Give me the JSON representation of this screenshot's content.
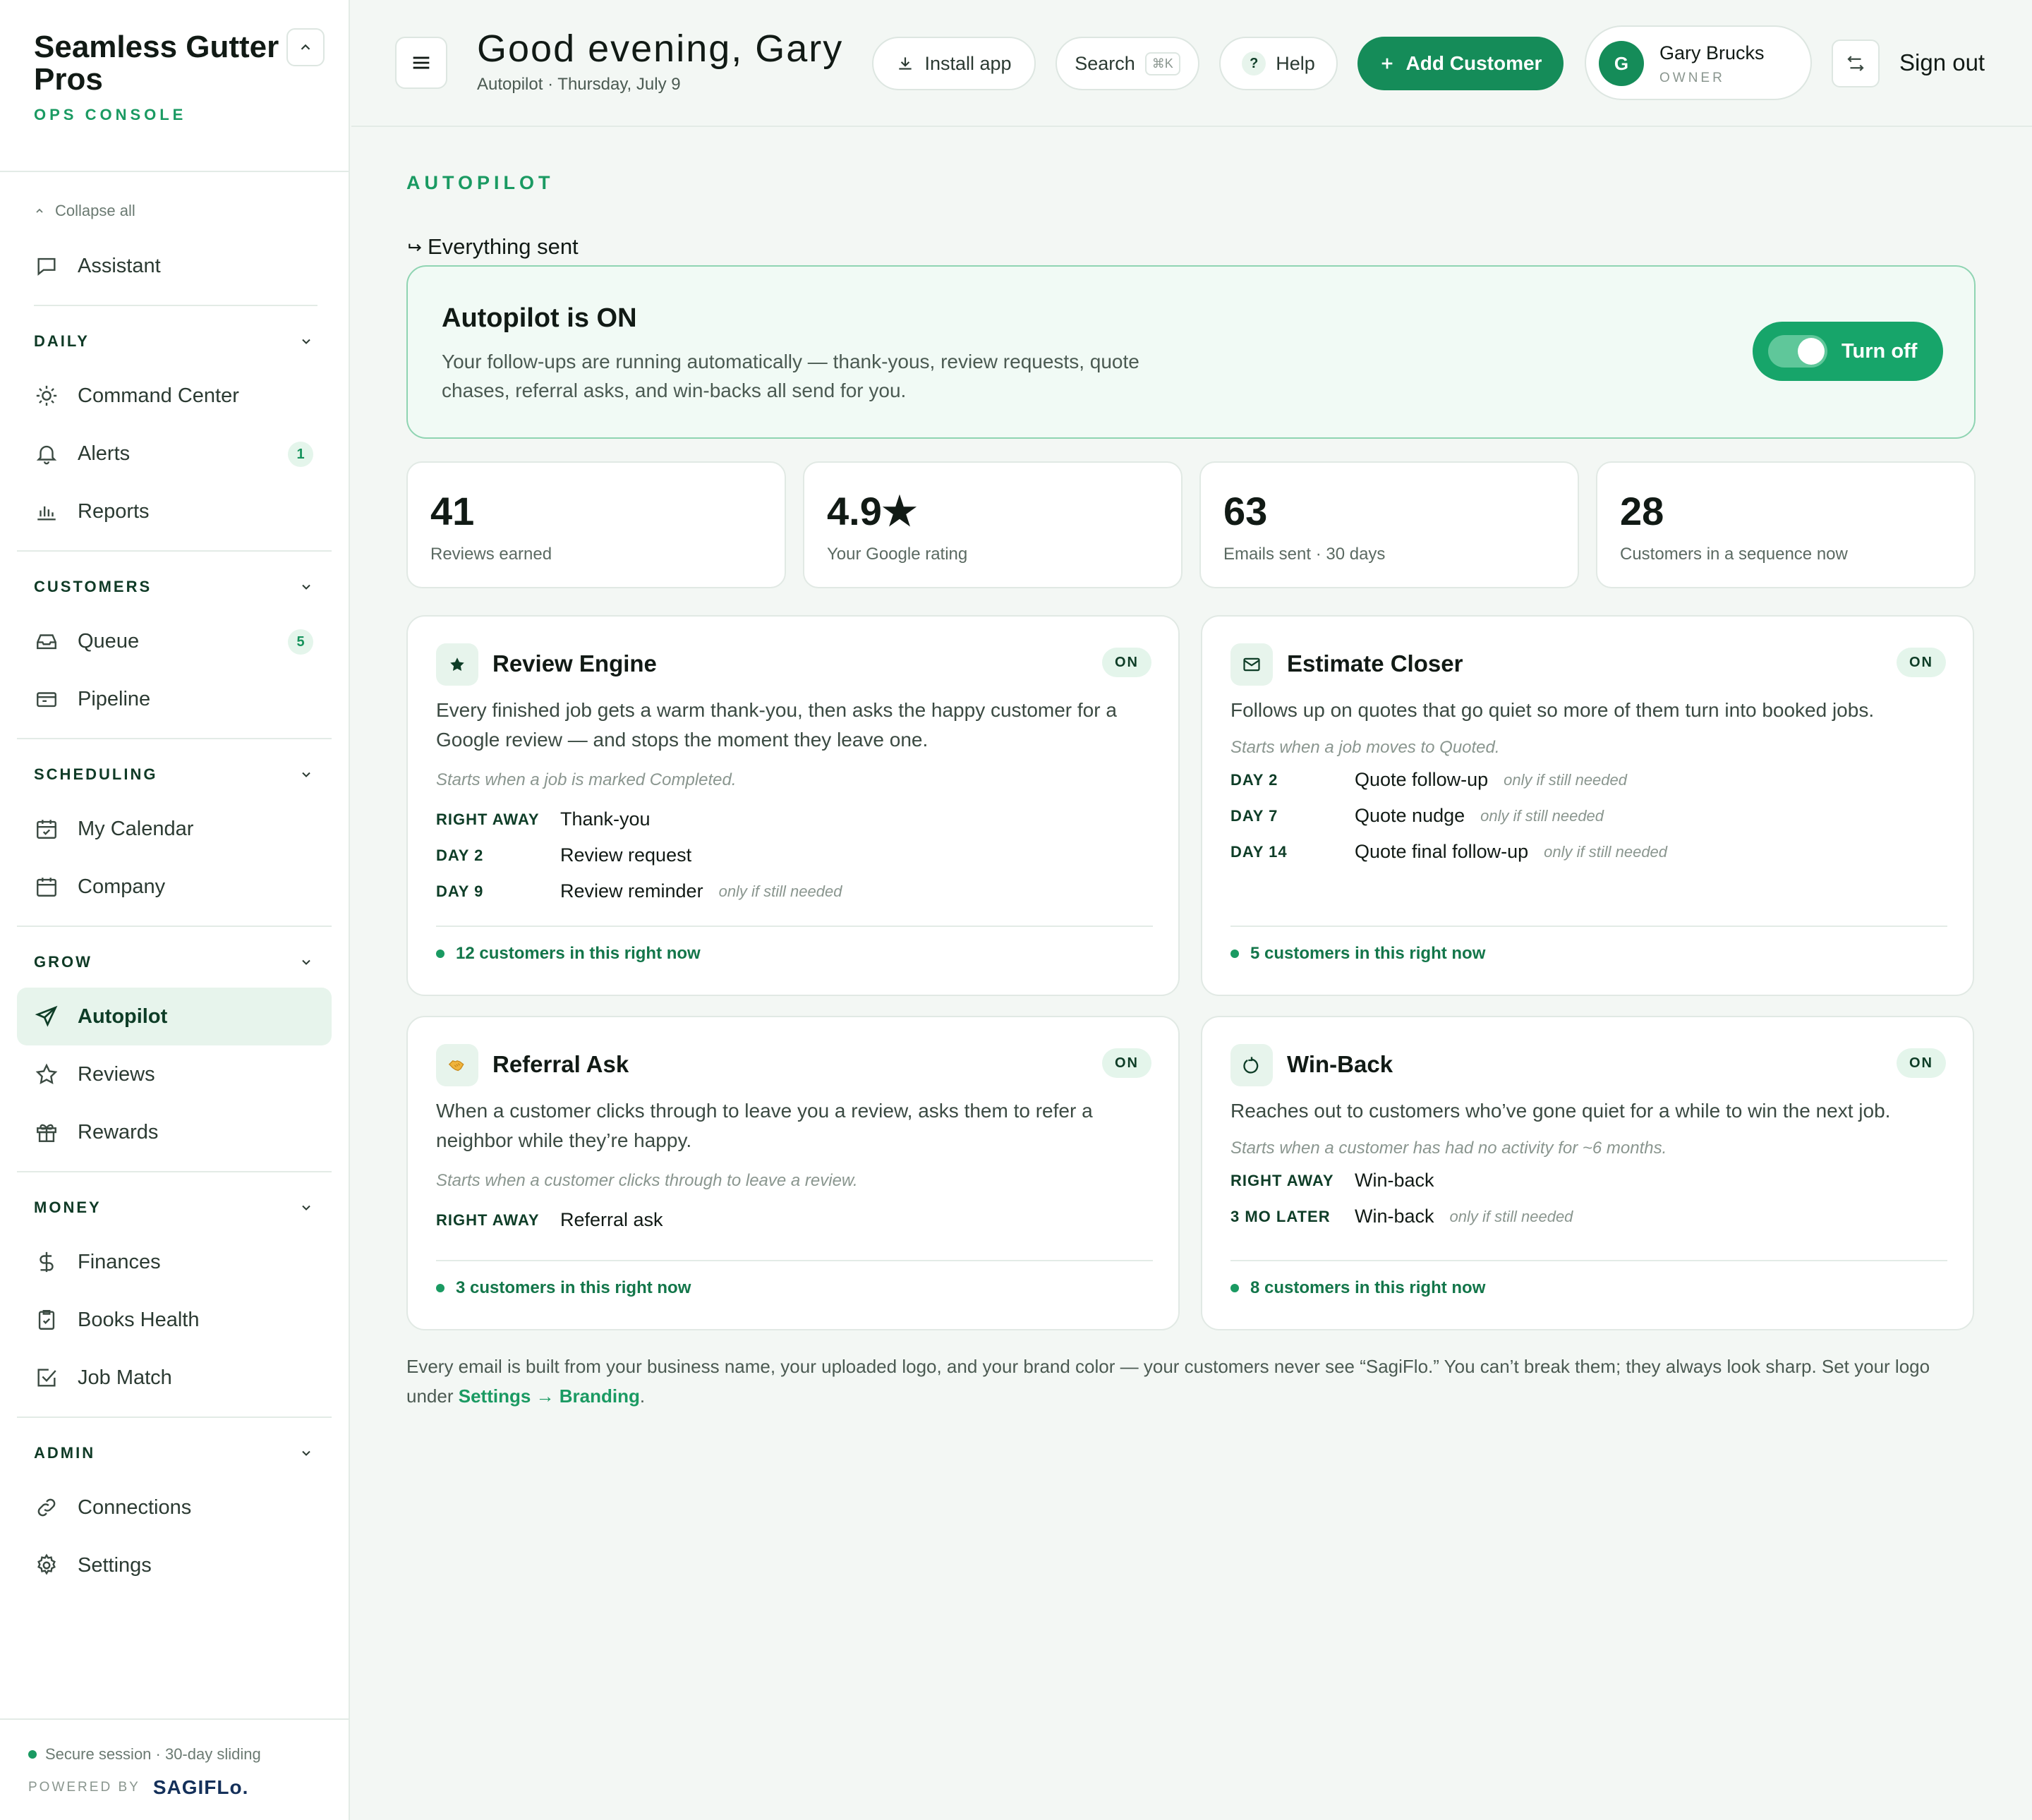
{
  "brand": {
    "name": "Seamless Gutter Pros",
    "subtitle": "OPS CONSOLE"
  },
  "sidebar": {
    "collapse_all": "Collapse all",
    "assistant": "Assistant",
    "sections": [
      {
        "label": "DAILY",
        "items": [
          {
            "label": "Command Center",
            "icon": "sun-icon"
          },
          {
            "label": "Alerts",
            "icon": "bell-icon",
            "badge": "1"
          },
          {
            "label": "Reports",
            "icon": "bar-chart-icon"
          }
        ]
      },
      {
        "label": "CUSTOMERS",
        "items": [
          {
            "label": "Queue",
            "icon": "inbox-icon",
            "badge": "5"
          },
          {
            "label": "Pipeline",
            "icon": "pipeline-icon"
          }
        ]
      },
      {
        "label": "SCHEDULING",
        "items": [
          {
            "label": "My Calendar",
            "icon": "calendar-check-icon"
          },
          {
            "label": "Company",
            "icon": "calendar-icon"
          }
        ]
      },
      {
        "label": "GROW",
        "items": [
          {
            "label": "Autopilot",
            "icon": "send-icon",
            "active": true
          },
          {
            "label": "Reviews",
            "icon": "star-icon"
          },
          {
            "label": "Rewards",
            "icon": "gift-icon"
          }
        ]
      },
      {
        "label": "MONEY",
        "items": [
          {
            "label": "Finances",
            "icon": "dollar-icon"
          },
          {
            "label": "Books Health",
            "icon": "clipboard-check-icon"
          },
          {
            "label": "Job Match",
            "icon": "checkbox-icon"
          }
        ]
      },
      {
        "label": "ADMIN",
        "items": [
          {
            "label": "Connections",
            "icon": "link-icon"
          },
          {
            "label": "Settings",
            "icon": "gear-icon"
          }
        ]
      }
    ],
    "session": "Secure session · 30-day sliding",
    "powered_by": "POWERED BY",
    "powered_logo": "SAGIFLo."
  },
  "header": {
    "greeting": "Good evening, Gary",
    "subtitle": "Autopilot · Thursday, July 9",
    "install": "Install app",
    "search": "Search",
    "search_kbd": "⌘K",
    "help": "Help",
    "help_glyph": "?",
    "add_customer": "Add Customer",
    "user_initial": "G",
    "user_name": "Gary Brucks",
    "user_role": "OWNER",
    "sign_out": "Sign out"
  },
  "main": {
    "eyebrow": "AUTOPILOT",
    "sent_link": "Everything sent",
    "hero": {
      "title": "Autopilot is ON",
      "description": "Your follow-ups are running automatically — thank-yous, review requests, quote chases, referral asks, and win-backs all send for you.",
      "toggle_label": "Turn off",
      "toggle_on": true
    },
    "stats": [
      {
        "value": "41",
        "label": "Reviews earned"
      },
      {
        "value": "4.9★",
        "label": "Your Google rating"
      },
      {
        "value": "63",
        "label": "Emails sent · 30 days"
      },
      {
        "value": "28",
        "label": "Customers in a sequence now"
      }
    ],
    "cards": [
      {
        "title": "Review Engine",
        "badge": "ON",
        "icon": "star-icon",
        "description": "Every finished job gets a warm thank-you, then asks the happy customer for a Google review — and stops the moment they leave one.",
        "trigger": "Starts when a job is marked Completed.",
        "steps": [
          {
            "when": "RIGHT AWAY",
            "name": "Thank-you",
            "note": ""
          },
          {
            "when": "DAY 2",
            "name": "Review request",
            "note": ""
          },
          {
            "when": "DAY 9",
            "name": "Review reminder",
            "note": "only if still needed"
          }
        ],
        "footer": "12 customers in this right now"
      },
      {
        "title": "Estimate Closer",
        "badge": "ON",
        "icon": "mail-icon",
        "description": "Follows up on quotes that go quiet so more of them turn into booked jobs.",
        "trigger": "Starts when a job moves to Quoted.",
        "steps": [
          {
            "when": "DAY 2",
            "name": "Quote follow-up",
            "note": "only if still needed"
          },
          {
            "when": "DAY 7",
            "name": "Quote nudge",
            "note": "only if still needed"
          },
          {
            "when": "DAY 14",
            "name": "Quote final follow-up",
            "note": "only if still needed"
          }
        ],
        "footer": "5 customers in this right now"
      },
      {
        "title": "Referral Ask",
        "badge": "ON",
        "icon": "handshake-icon",
        "description": "When a customer clicks through to leave you a review, asks them to refer a neighbor while they’re happy.",
        "trigger": "Starts when a customer clicks through to leave a review.",
        "steps": [
          {
            "when": "RIGHT AWAY",
            "name": "Referral ask",
            "note": ""
          }
        ],
        "footer": "3 customers in this right now"
      },
      {
        "title": "Win-Back",
        "badge": "ON",
        "icon": "refresh-icon",
        "description": "Reaches out to customers who’ve gone quiet for a while to win the next job.",
        "trigger": "Starts when a customer has had no activity for ~6 months.",
        "steps": [
          {
            "when": "RIGHT AWAY",
            "name": "Win-back",
            "note": ""
          },
          {
            "when": "3 MO LATER",
            "name": "Win-back",
            "note": "only if still needed"
          }
        ],
        "footer": "8 customers in this right now"
      }
    ],
    "footnote_text": "Every email is built from your business name, your uploaded logo, and your brand color — your customers never see “SagiFlo.” You can’t break them; they always look sharp. Set your logo under ",
    "footnote_link": "Settings → Branding",
    "footnote_end": "."
  },
  "colors": {
    "accent": "#1a9a62",
    "button": "#158c59",
    "hero_border": "#8fd4b2",
    "background": "#f3f7f4"
  }
}
